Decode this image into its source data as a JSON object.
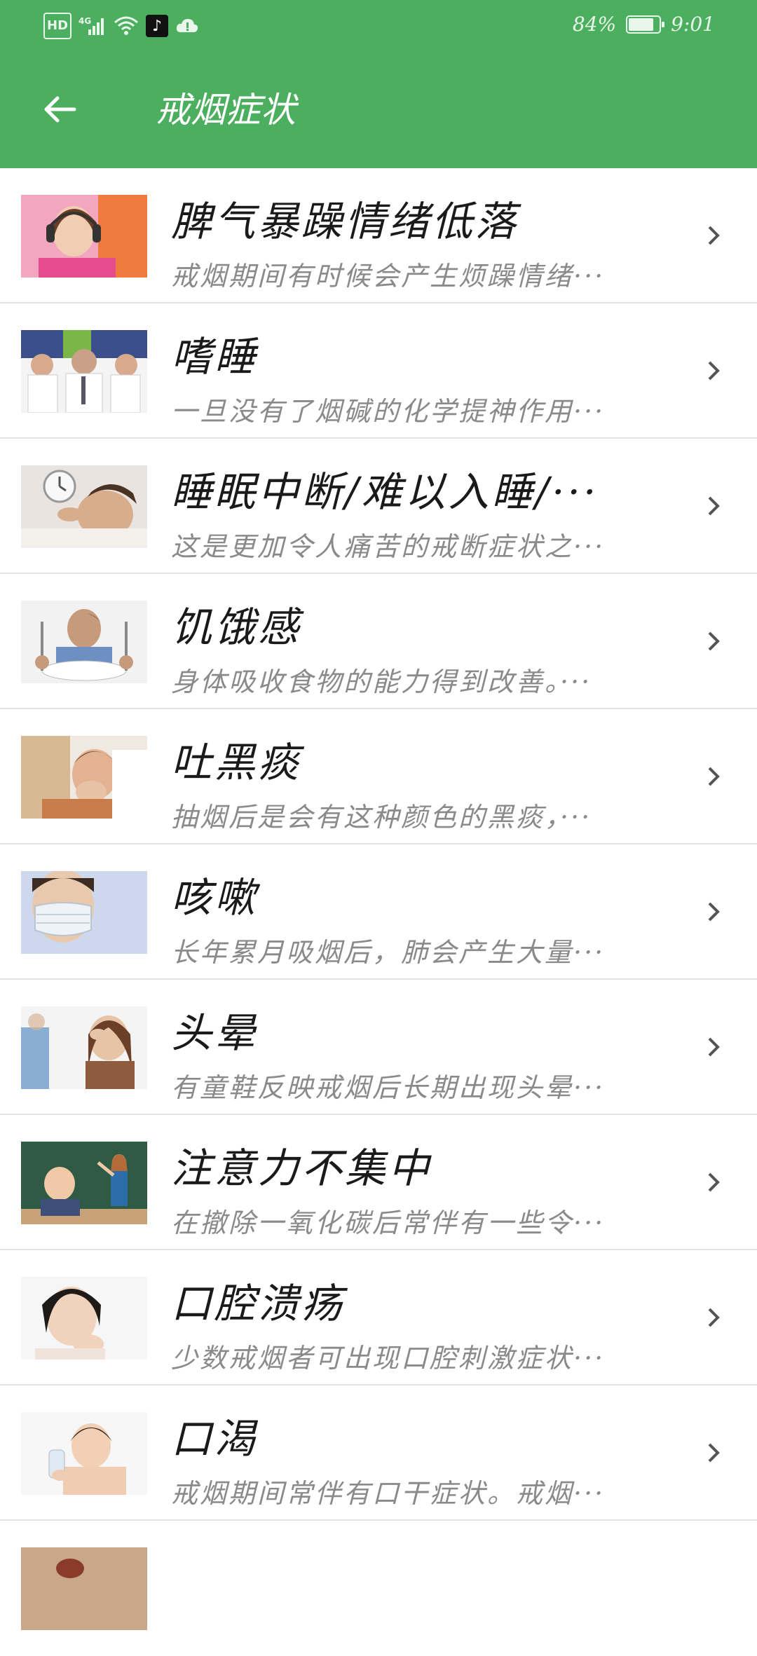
{
  "status_bar": {
    "hd_label": "HD",
    "network_label": "4G",
    "battery_percent": "84%",
    "battery_level": 0.84,
    "time": "9:01"
  },
  "app_bar": {
    "title": "戒烟症状",
    "back_icon": "arrow-left-icon"
  },
  "colors": {
    "primary": "#4caf5f",
    "title_text": "#1a1a1a",
    "desc_text": "#8a8a8a",
    "divider": "#e2e2e2"
  },
  "items": [
    {
      "title": "脾气暴躁情绪低落",
      "desc": "戒烟期间有时候会产生烦躁情绪···"
    },
    {
      "title": "嗜睡",
      "desc": "一旦没有了烟碱的化学提神作用···"
    },
    {
      "title": "睡眠中断/难以入睡/···",
      "desc": "这是更加令人痛苦的戒断症状之···"
    },
    {
      "title": "饥饿感",
      "desc": "身体吸收食物的能力得到改善。···"
    },
    {
      "title": "吐黑痰",
      "desc": "抽烟后是会有这种颜色的黑痰，···"
    },
    {
      "title": "咳嗽",
      "desc": "长年累月吸烟后，肺会产生大量···"
    },
    {
      "title": "头晕",
      "desc": "有童鞋反映戒烟后长期出现头晕···"
    },
    {
      "title": "注意力不集中",
      "desc": "在撤除一氧化碳后常伴有一些令···"
    },
    {
      "title": "口腔溃疡",
      "desc": "少数戒烟者可出现口腔刺激症状···"
    },
    {
      "title": "口渴",
      "desc": "戒烟期间常伴有口干症状。戒烟···"
    }
  ]
}
